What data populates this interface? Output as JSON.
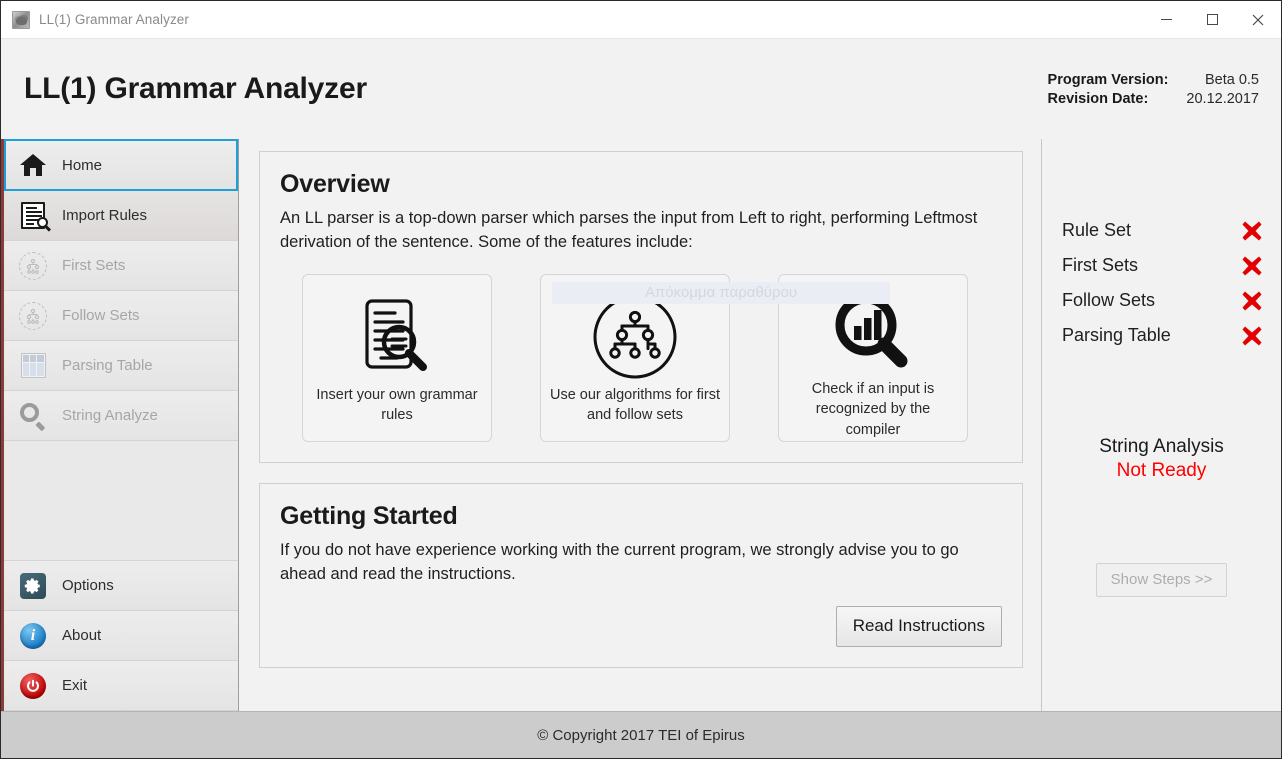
{
  "titlebar": {
    "title": "LL(1) Grammar Analyzer",
    "app_icon": "app-icon",
    "minimize_label": "Minimize",
    "maximize_label": "Maximize",
    "close_label": "Close"
  },
  "header": {
    "app_title": "LL(1) Grammar Analyzer",
    "version_label": "Program Version:",
    "version_value": "Beta 0.5",
    "revision_label": "Revision Date:",
    "revision_value": "20.12.2017"
  },
  "sidebar": {
    "items": [
      {
        "label": "Home",
        "icon": "home-icon",
        "state": "selected"
      },
      {
        "label": "Import Rules",
        "icon": "import-rules-icon",
        "state": "hover"
      },
      {
        "label": "First Sets",
        "icon": "first-sets-icon",
        "state": "disabled"
      },
      {
        "label": "Follow Sets",
        "icon": "follow-sets-icon",
        "state": "disabled"
      },
      {
        "label": "Parsing Table",
        "icon": "parsing-table-icon",
        "state": "disabled"
      },
      {
        "label": "String Analyze",
        "icon": "string-analyze-icon",
        "state": "disabled"
      }
    ],
    "bottom_items": [
      {
        "label": "Options",
        "icon": "gear-icon"
      },
      {
        "label": "About",
        "icon": "info-icon"
      },
      {
        "label": "Exit",
        "icon": "power-icon"
      }
    ]
  },
  "overview": {
    "heading": "Overview",
    "body": "An LL parser is a top-down parser which parses the input from Left to right, performing Leftmost derivation of the sentence. Some of the features include:",
    "cards": [
      {
        "icon": "document-search-icon",
        "caption": "Insert your own grammar rules"
      },
      {
        "icon": "tree-diagram-icon",
        "caption": "Use our algorithms for first and follow sets"
      },
      {
        "icon": "chart-search-icon",
        "caption": "Check if an input is recognized by the compiler"
      }
    ]
  },
  "ghost_tooltip": {
    "text": "Απόκομμα παραθύρου"
  },
  "getting_started": {
    "heading": "Getting Started",
    "body": "If you do not have experience working with the current program, we strongly advise you to go ahead and read the instructions.",
    "button_label": "Read Instructions"
  },
  "status_panel": {
    "rows": [
      {
        "label": "Rule Set",
        "status": "not-done",
        "icon": "red-x-icon"
      },
      {
        "label": "First Sets",
        "status": "not-done",
        "icon": "red-x-icon"
      },
      {
        "label": "Follow Sets",
        "status": "not-done",
        "icon": "red-x-icon"
      },
      {
        "label": "Parsing Table",
        "status": "not-done",
        "icon": "red-x-icon"
      }
    ],
    "analysis_title": "String Analysis",
    "analysis_state": "Not Ready",
    "show_steps_label": "Show Steps >>",
    "show_steps_enabled": false
  },
  "footer": {
    "copyright": "© Copyright 2017 TEI of Epirus"
  },
  "colors": {
    "accent_selected": "#1e9fd8",
    "sidebar_edge": "#8c3a3a",
    "error_red": "#ff0000",
    "x_red": "#e40000",
    "footer_bg": "#cccccc"
  }
}
